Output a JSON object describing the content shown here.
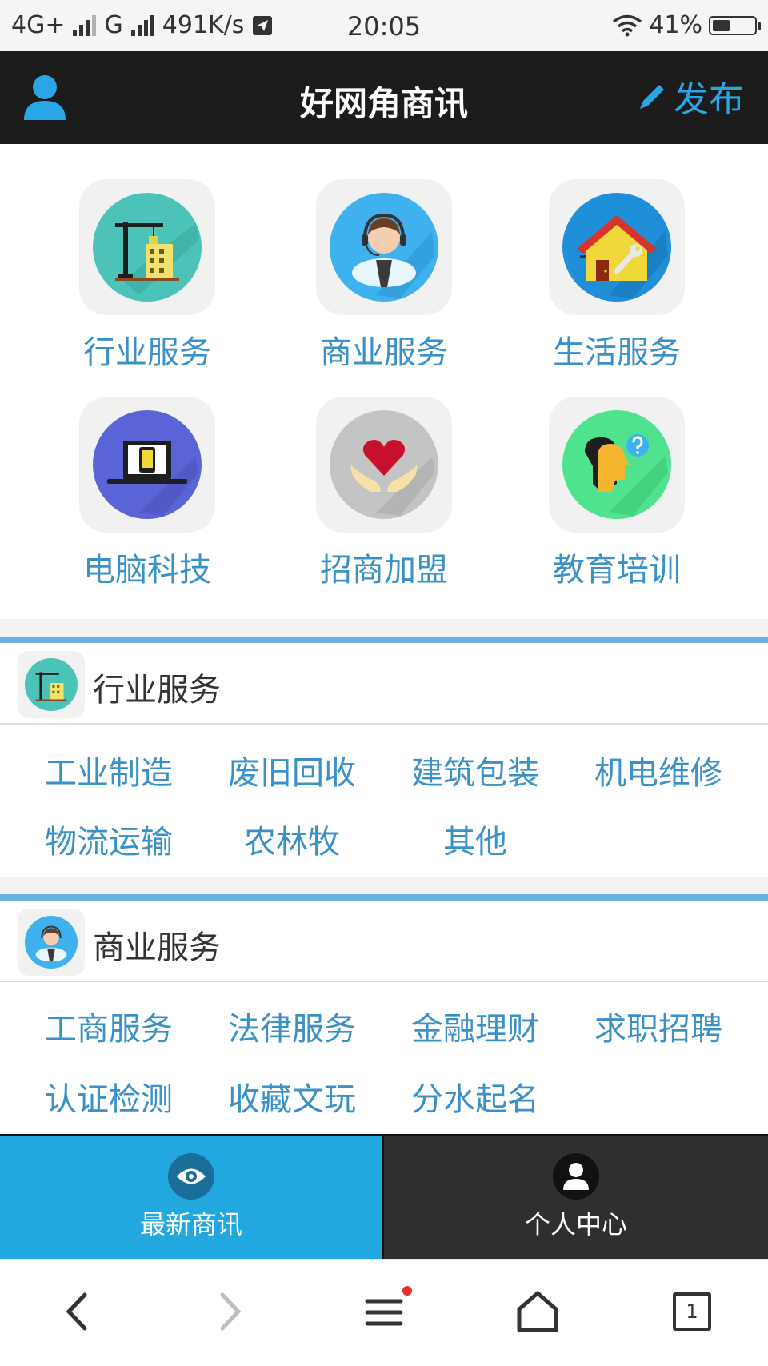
{
  "status_bar": {
    "network1": "4G+",
    "network2": "G",
    "speed": "491K/s",
    "time": "20:05",
    "battery": "41%",
    "battery_level": 0.41
  },
  "header": {
    "title": "好网角商讯",
    "publish_label": "发布"
  },
  "categories": [
    {
      "label": "行业服务",
      "icon": "crane-building-icon",
      "color": "#4bc3b8"
    },
    {
      "label": "商业服务",
      "icon": "customer-service-icon",
      "color": "#3fb1ee"
    },
    {
      "label": "生活服务",
      "icon": "house-wrench-icon",
      "color": "#1e8fd8"
    },
    {
      "label": "电脑科技",
      "icon": "laptop-icon",
      "color": "#5b64d6"
    },
    {
      "label": "招商加盟",
      "icon": "heart-hands-icon",
      "color": "#c4c4c4"
    },
    {
      "label": "教育培训",
      "icon": "head-question-icon",
      "color": "#4fe38f"
    }
  ],
  "sections": [
    {
      "title": "行业服务",
      "icon": "crane-building-icon",
      "items": [
        "工业制造",
        "废旧回收",
        "建筑包装",
        "机电维修",
        "物流运输",
        "农林牧",
        "其他"
      ]
    },
    {
      "title": "商业服务",
      "icon": "customer-service-icon",
      "items": [
        "工商服务",
        "法律服务",
        "金融理财",
        "求职招聘",
        "认证检测",
        "收藏文玩",
        "分水起名"
      ]
    }
  ],
  "tabs": [
    {
      "label": "最新商讯",
      "icon": "eye-icon"
    },
    {
      "label": "个人中心",
      "icon": "person-icon"
    }
  ],
  "browser": {
    "tab_count": "1"
  },
  "colors": {
    "accent": "#2aa6e6",
    "link_text": "#3a91c8",
    "header_bg": "#1c1c1c",
    "tab_active_bg": "#22a8de",
    "tab_inactive_bg": "#2f2f2f"
  }
}
